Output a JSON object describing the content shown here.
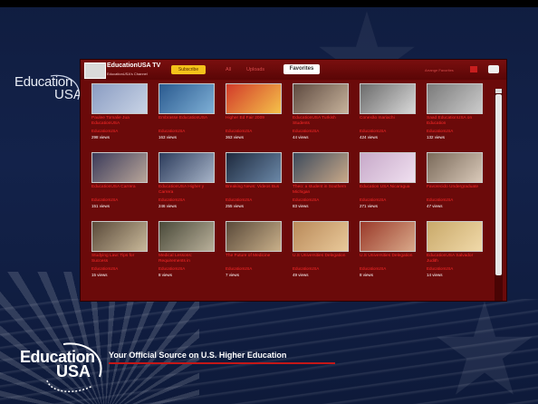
{
  "logo_top": {
    "line1": "Education",
    "line2": "USA"
  },
  "channel": {
    "title": "EducationUSA TV",
    "subtitle": "EducationUSA's Channel",
    "subscribe_label": "Subscribe",
    "tabs": [
      "All",
      "Uploads",
      "Favorites"
    ],
    "active_tab": "Favorites",
    "arrange_label": "Arrange Favorites"
  },
  "videos": [
    {
      "title": "Paulee Tomalie Jua EducationUSA",
      "channel": "EducationUSA",
      "views": "298 views",
      "thumb": [
        "#8a9cc2",
        "#c9d4e6"
      ]
    },
    {
      "title": "Embrasse EducationUSA",
      "channel": "EducationUSA",
      "views": "163 views",
      "thumb": [
        "#2a5a8f",
        "#7fb0d6"
      ]
    },
    {
      "title": "Higher Ed Fair 2009",
      "channel": "EducationUSA",
      "views": "363 views",
      "thumb": [
        "#d23a2a",
        "#f5c24a"
      ]
    },
    {
      "title": "EducationUSA Turkish Students",
      "channel": "EducationUSA",
      "views": "44 views",
      "thumb": [
        "#5e4a40",
        "#c7b39c"
      ]
    },
    {
      "title": "Conexão mariachi",
      "channel": "EducationUSA",
      "views": "424 views",
      "thumb": [
        "#6b6b6b",
        "#d9d9d9"
      ]
    },
    {
      "title": "Saad EducationUSA on Education",
      "channel": "EducationUSA",
      "views": "132 views",
      "thumb": [
        "#7a7a7a",
        "#cccccc"
      ]
    },
    {
      "title": "EducationUSA Carrera",
      "channel": "EducationUSA",
      "views": "151 views",
      "thumb": [
        "#3b3b5a",
        "#b9a69a"
      ]
    },
    {
      "title": "EducationUSA Higher y Carrera",
      "channel": "EducationUSA",
      "views": "246 views",
      "thumb": [
        "#2c3c5c",
        "#a7b4c8"
      ]
    },
    {
      "title": "Breaking News: Videos Bus",
      "channel": "EducationUSA",
      "views": "255 views",
      "thumb": [
        "#1e2a3e",
        "#6b88a8"
      ]
    },
    {
      "title": "Theo: a student in Southern Michigan",
      "channel": "EducationUSA",
      "views": "83 views",
      "thumb": [
        "#3c4a5c",
        "#c9a989"
      ]
    },
    {
      "title": "Education USA Nicaragua",
      "channel": "EducationUSA",
      "views": "271 views",
      "thumb": [
        "#c7a9c9",
        "#f0e0f0"
      ]
    },
    {
      "title": "Favorecido Undergraduate",
      "channel": "EducationUSA",
      "views": "47 views",
      "thumb": [
        "#7a6a5a",
        "#d9c9b9"
      ]
    },
    {
      "title": "Studying Law: Tips for Success",
      "channel": "EducationUSA",
      "views": "15 views",
      "thumb": [
        "#5a4a3a",
        "#c9b99a"
      ]
    },
    {
      "title": "Medical Lessons: Requirements in",
      "channel": "EducationUSA",
      "views": "8 views",
      "thumb": [
        "#4a4a3a",
        "#b9b09a"
      ]
    },
    {
      "title": "The Future of Medicine",
      "channel": "EducationUSA",
      "views": "7 views",
      "thumb": [
        "#5a4a3a",
        "#c9b08a"
      ]
    },
    {
      "title": "U.S Universities Delegation",
      "channel": "EducationUSA",
      "views": "49 views",
      "thumb": [
        "#b98a5a",
        "#e9c99a"
      ]
    },
    {
      "title": "U.S Universities Delegation",
      "channel": "EducationUSA",
      "views": "8 views",
      "thumb": [
        "#9a3a2a",
        "#d9a98a"
      ]
    },
    {
      "title": "EducationUSA Salvador Judith",
      "channel": "EducationUSA",
      "views": "14 views",
      "thumb": [
        "#c9a96a",
        "#f0d9a9"
      ]
    }
  ],
  "footer": {
    "logo_line1": "Education",
    "logo_line2": "USA",
    "tagline": "Your Official Source on U.S. Higher Education"
  }
}
